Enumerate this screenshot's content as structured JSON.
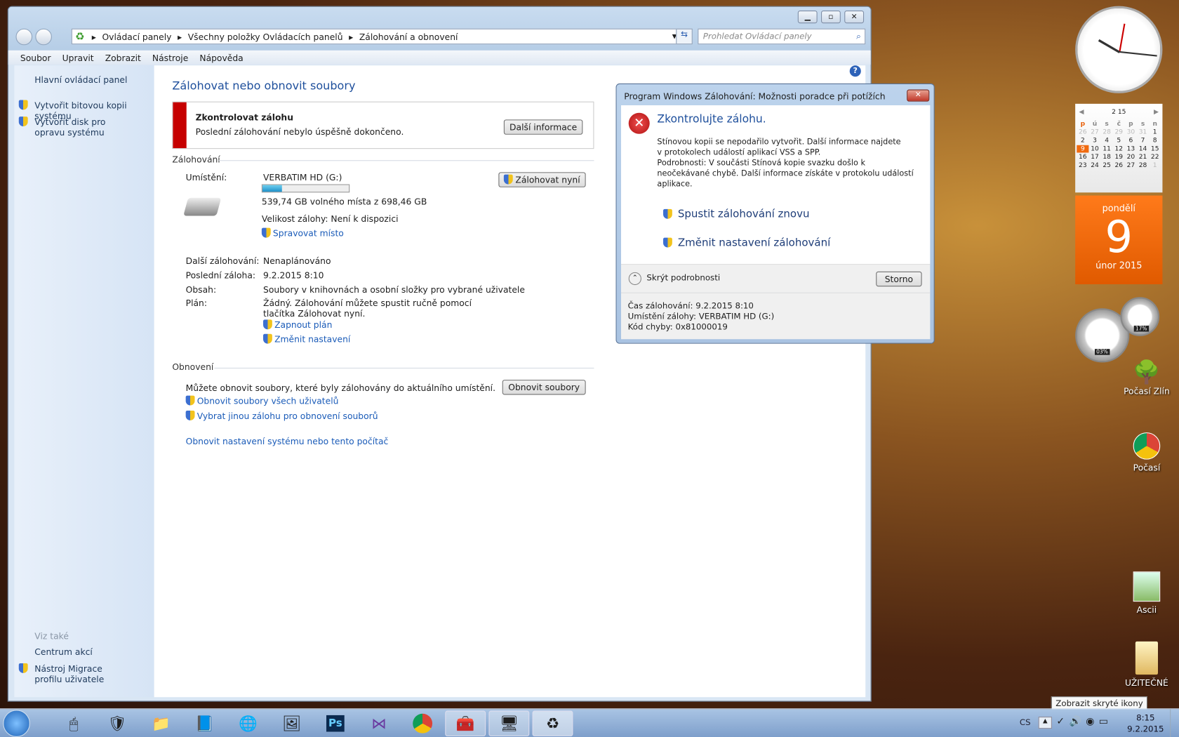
{
  "window": {
    "breadcrumb": [
      "Ovládací panely",
      "Všechny položky Ovládacích panelů",
      "Zálohování a obnovení"
    ],
    "search_placeholder": "Prohledat Ovládací panely",
    "menu": [
      "Soubor",
      "Upravit",
      "Zobrazit",
      "Nástroje",
      "Nápověda"
    ],
    "sidebar": {
      "home": "Hlavní ovládací panel",
      "items": [
        "Vytvořit bitovou kopii systému",
        "Vytvořit disk pro opravu systému"
      ],
      "see_also": "Viz také",
      "see_items": [
        "Centrum akcí",
        "Nástroj Migrace profilu uživatele"
      ]
    },
    "title": "Zálohovat nebo obnovit soubory",
    "alert": {
      "title": "Zkontrolovat zálohu",
      "text": "Poslední zálohování nebylo úspěšně dokončeno.",
      "button": "Další informace"
    },
    "backup": {
      "heading": "Zálohování",
      "location_label": "Umístění:",
      "drive": "VERBATIM HD (G:)",
      "usage_percent": 23,
      "free": "539,74 GB volného místa z 698,46 GB",
      "size": "Velikost zálohy: Není k dispozici",
      "manage": "Spravovat místo",
      "backup_now": "Zálohovat nyní",
      "rows": [
        {
          "label": "Další zálohování:",
          "value": "Nenaplánováno"
        },
        {
          "label": "Poslední záloha:",
          "value": "9.2.2015 8:10"
        },
        {
          "label": "Obsah:",
          "value": "Soubory v knihovnách a osobní složky pro vybrané uživatele"
        },
        {
          "label": "Plán:",
          "value": "Žádný. Zálohování můžete spustit ručně pomocí tlačítka Zálohovat nyní."
        }
      ],
      "enable_schedule": "Zapnout plán",
      "change_settings": "Změnit nastavení"
    },
    "restore": {
      "heading": "Obnovení",
      "text": "Můžete obnovit soubory, které byly zálohovány do aktuálního umístění.",
      "button": "Obnovit soubory",
      "all_users": "Obnovit soubory všech uživatelů",
      "other_backup": "Vybrat jinou zálohu pro obnovení souborů",
      "system": "Obnovit nastavení systému nebo tento počítač"
    }
  },
  "dialog": {
    "title": "Program Windows Zálohování: Možnosti poradce při potížích",
    "heading": "Zkontrolujte zálohu.",
    "text1": "Stínovou kopii se nepodařilo vytvořit. Další informace najdete v protokolech událostí aplikací VSS a SPP.",
    "text2": "Podrobnosti: V součásti Stínová kopie svazku došlo k neočekávané chybě. Další informace získáte v protokolu událostí aplikace.",
    "option1": "Spustit zálohování znovu",
    "option2": "Změnit nastavení zálohování",
    "hide_details": "Skrýt podrobnosti",
    "cancel": "Storno",
    "details": [
      "Čas zálohování: 9.2.2015 8:10",
      "Umístění zálohy: VERBATIM HD (G:)",
      "Kód chyby: 0x81000019"
    ]
  },
  "gadgets": {
    "calendar": {
      "month": "2 15",
      "days": [
        "p",
        "ú",
        "s",
        "č",
        "p",
        "s",
        "n"
      ],
      "weeks": [
        [
          "26",
          "27",
          "28",
          "29",
          "30",
          "31",
          "1"
        ],
        [
          "2",
          "3",
          "4",
          "5",
          "6",
          "7",
          "8"
        ],
        [
          "9",
          "10",
          "11",
          "12",
          "13",
          "14",
          "15"
        ],
        [
          "16",
          "17",
          "18",
          "19",
          "20",
          "21",
          "22"
        ],
        [
          "23",
          "24",
          "25",
          "26",
          "27",
          "28",
          "1"
        ]
      ],
      "weekday": "pondělí",
      "day": "9",
      "month_year": "únor 2015"
    },
    "meter": {
      "cpu": "03%",
      "mem": "17%"
    }
  },
  "desktop_icons": [
    "Počasí Zlín",
    "Počasí",
    "Ascii",
    "UŽITEČNÉ"
  ],
  "tooltip": "Zobrazit skryté ikony",
  "tray": {
    "lang": "CS",
    "time": "8:15",
    "date": "9.2.2015"
  }
}
